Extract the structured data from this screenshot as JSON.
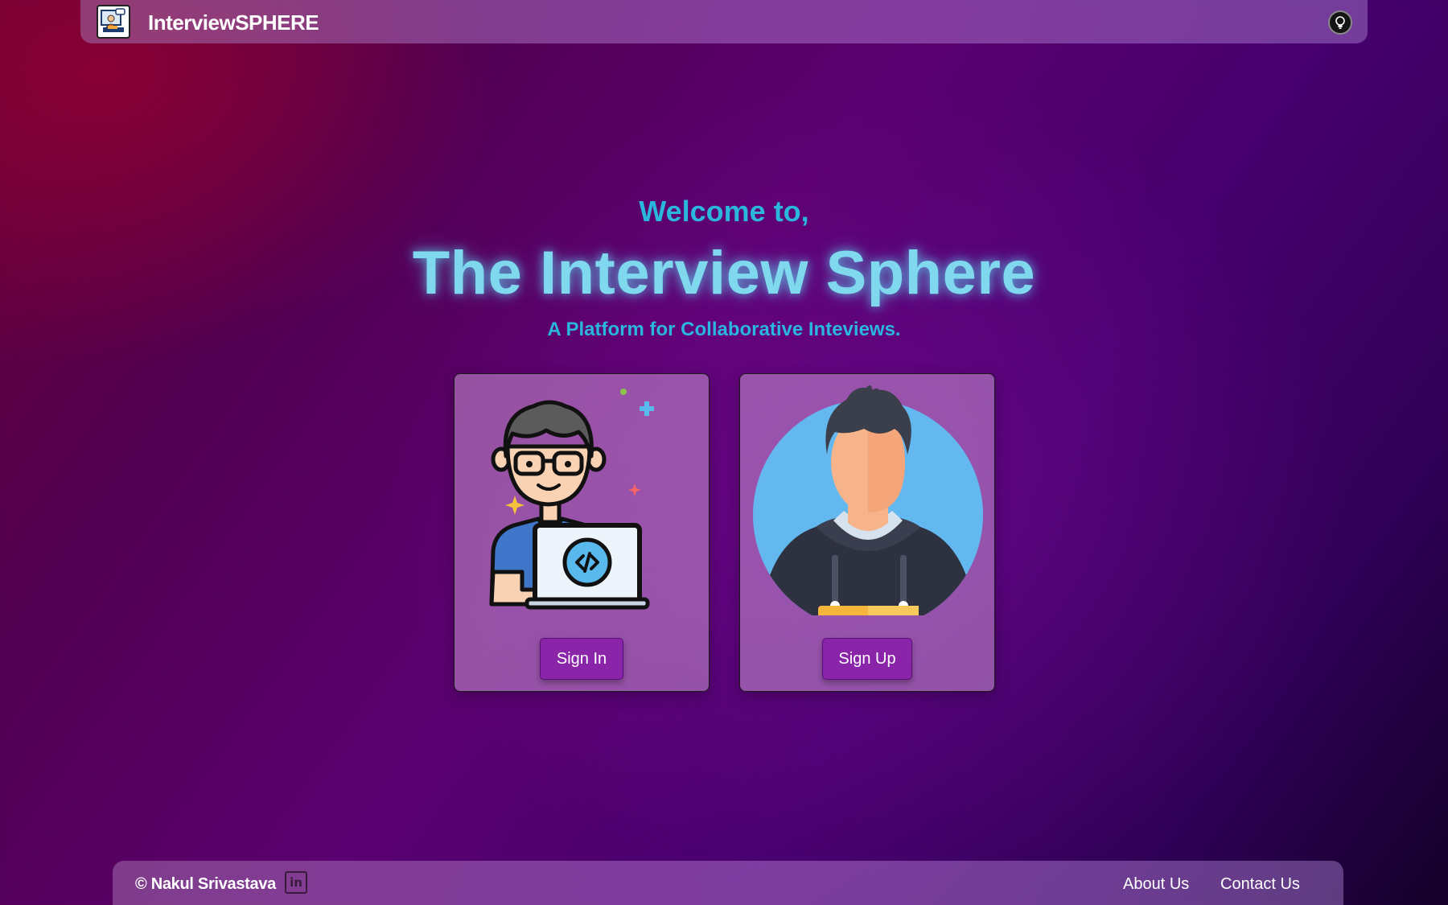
{
  "navbar": {
    "brand": "InterviewSPHERE",
    "logo_icon": "interview-logo-icon",
    "theme_toggle_icon": "lightbulb-icon"
  },
  "hero": {
    "welcome": "Welcome to,",
    "title": "The Interview Sphere",
    "subtitle": "A Platform for Collaborative Inteviews."
  },
  "cards": {
    "signin": {
      "illustration_icon": "developer-laptop-icon",
      "button_label": "Sign In"
    },
    "signup": {
      "illustration_icon": "user-avatar-icon",
      "button_label": "Sign Up"
    }
  },
  "footer": {
    "copyright": "© Nakul Srivastava",
    "linkedin_icon": "linkedin-icon",
    "linkedin_text": "in",
    "about_label": "About Us",
    "contact_label": "Contact Us"
  },
  "colors": {
    "accent_text": "#2ab6dd",
    "title_glow": "#7fd8ee",
    "button_bg": "#8a24a8"
  }
}
